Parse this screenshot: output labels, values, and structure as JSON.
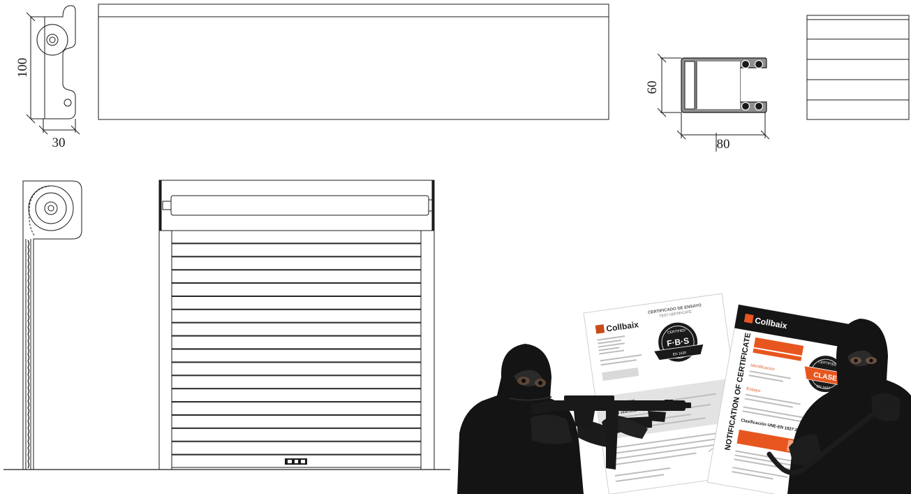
{
  "dimensions": {
    "slat_height": "100",
    "slat_depth": "30",
    "guide_height": "60",
    "guide_width": "80"
  },
  "certificates": {
    "test_certificate": {
      "brand": "Collbaix",
      "title_es": "CERTIFICADO DE ENSAYO",
      "title_en": "TEST CERTIFICATE",
      "seal_top": "CERTIFIED",
      "seal_mid": "F·B·S",
      "seal_bottom": "EN 1630",
      "norm_line_1": "UNE EN 1627:2011",
      "norm_line_2": "UNE EN 1630:2011"
    },
    "notification_certificate": {
      "brand": "Collbaix",
      "title": "NOTIFICATION OF CERTIFICATE",
      "seal_top": "CERTIFIED",
      "seal_mid": "CLASE",
      "seal_bottom": "EN 1627",
      "section_1": "Identificación",
      "section_2": "Ensayo",
      "classification": "Clasificación UNE-EN 1627:2011"
    }
  },
  "colors": {
    "line": "#1a1a1a",
    "profile_fill": "#8f8f8f",
    "cert_orange": "#e8561f",
    "cert_black": "#151515",
    "figure_black": "#141414"
  }
}
